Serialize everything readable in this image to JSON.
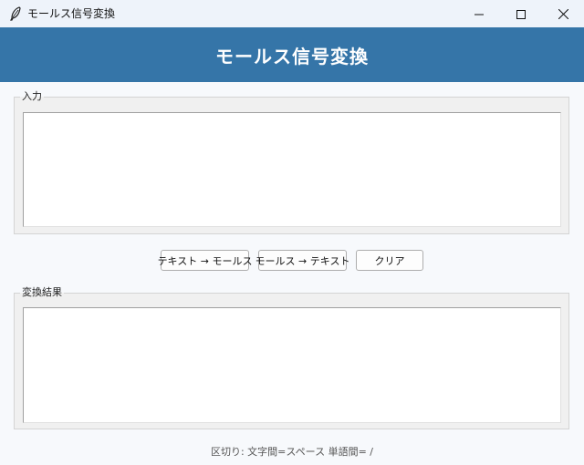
{
  "window": {
    "title": "モールス信号変換"
  },
  "banner": {
    "title": "モールス信号変換"
  },
  "input_section": {
    "label": "入力",
    "value": ""
  },
  "buttons": {
    "text_to_morse": "テキスト → モールス",
    "morse_to_text": "モールス → テキスト",
    "clear": "クリア"
  },
  "output_section": {
    "label": "変換結果",
    "value": ""
  },
  "footer": {
    "hint": "区切り: 文字間=スペース  単語間= /"
  },
  "colors": {
    "banner": "#3575a8",
    "titlebar": "#eef3fa",
    "background": "#f7f9fc"
  },
  "icons": {
    "app": "feather-icon",
    "minimize": "minimize-icon",
    "maximize": "maximize-icon",
    "close": "close-icon"
  }
}
